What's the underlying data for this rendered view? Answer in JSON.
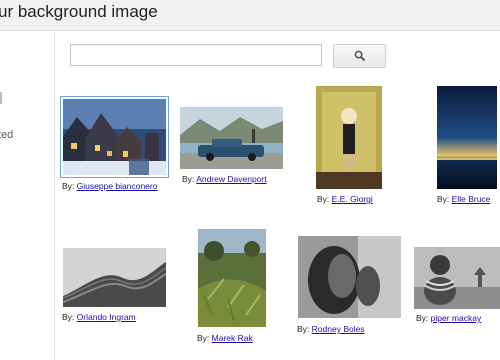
{
  "header": {
    "title": "ur background image"
  },
  "sidebar": {
    "fragment": "ted"
  },
  "search": {
    "value": "",
    "placeholder": "",
    "button_icon": "search-icon"
  },
  "credit_prefix": "By:",
  "photos": [
    {
      "author": "Giuseppe bianconero",
      "subject": "snowy village at night",
      "selected": true
    },
    {
      "author": "Andrew Davenport",
      "subject": "classic car by a lake"
    },
    {
      "author": "E.E. Giorgi",
      "subject": "figure holding a lamp"
    },
    {
      "author": "Elle Bruce",
      "subject": "sunset over water"
    },
    {
      "author": "Orlando Ingram",
      "subject": "curved modern building"
    },
    {
      "author": "Marek Rak",
      "subject": "fern forest"
    },
    {
      "author": "Rodney Boles",
      "subject": "face portrait in black and white"
    },
    {
      "author": "piper mackay",
      "subject": "woman in beaded necklaces"
    }
  ]
}
